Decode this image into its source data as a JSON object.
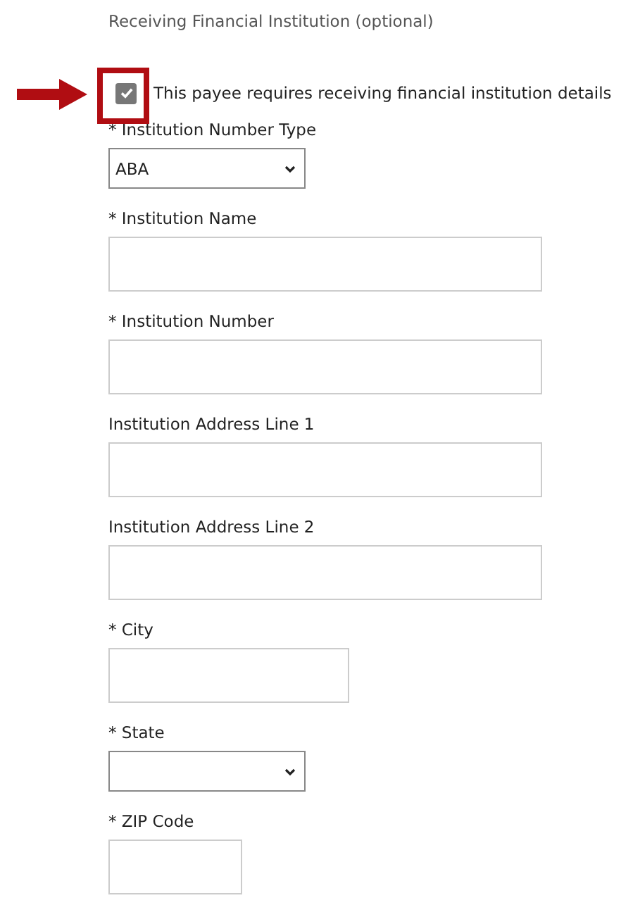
{
  "section_title": "Receiving Financial Institution (optional)",
  "requires_details": {
    "label": "This payee requires receiving financial institution details",
    "checked": true
  },
  "fields": [
    {
      "label": "* Institution Number Type",
      "kind": "select",
      "value": "ABA"
    },
    {
      "label": "* Institution Name",
      "kind": "text"
    },
    {
      "label": "* Institution Number",
      "kind": "text"
    },
    {
      "label": "Institution Address Line 1",
      "kind": "text"
    },
    {
      "label": "Institution Address Line 2",
      "kind": "text"
    },
    {
      "label": "* City",
      "kind": "text"
    },
    {
      "label": "* State",
      "kind": "select"
    },
    {
      "label": "* ZIP Code",
      "kind": "text"
    }
  ]
}
